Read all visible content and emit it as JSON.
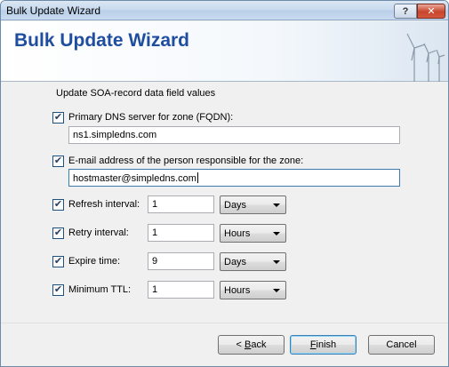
{
  "window": {
    "title": "Bulk Update Wizard",
    "help_label": "?",
    "close_label": "✕"
  },
  "header": {
    "title": "Bulk Update Wizard"
  },
  "form": {
    "intro": "Update SOA-record data field values",
    "check_mark": "✔",
    "primary_dns": {
      "label": "Primary DNS server for zone (FQDN):",
      "checked": true,
      "value": "ns1.simpledns.com"
    },
    "email": {
      "label": "E-mail address of the person responsible for the zone:",
      "checked": true,
      "value": "hostmaster@simpledns.com"
    },
    "refresh": {
      "label": "Refresh interval:",
      "checked": true,
      "value": "1",
      "unit": "Days"
    },
    "retry": {
      "label": "Retry interval:",
      "checked": true,
      "value": "1",
      "unit": "Hours"
    },
    "expire": {
      "label": "Expire time:",
      "checked": true,
      "value": "9",
      "unit": "Days"
    },
    "minttl": {
      "label": "Minimum TTL:",
      "checked": true,
      "value": "1",
      "unit": "Hours"
    }
  },
  "buttons": {
    "back_mnemonic": "B",
    "back_rest": "ack",
    "back_prefix": "< ",
    "finish_mnemonic": "F",
    "finish_rest": "inish",
    "cancel": "Cancel"
  }
}
